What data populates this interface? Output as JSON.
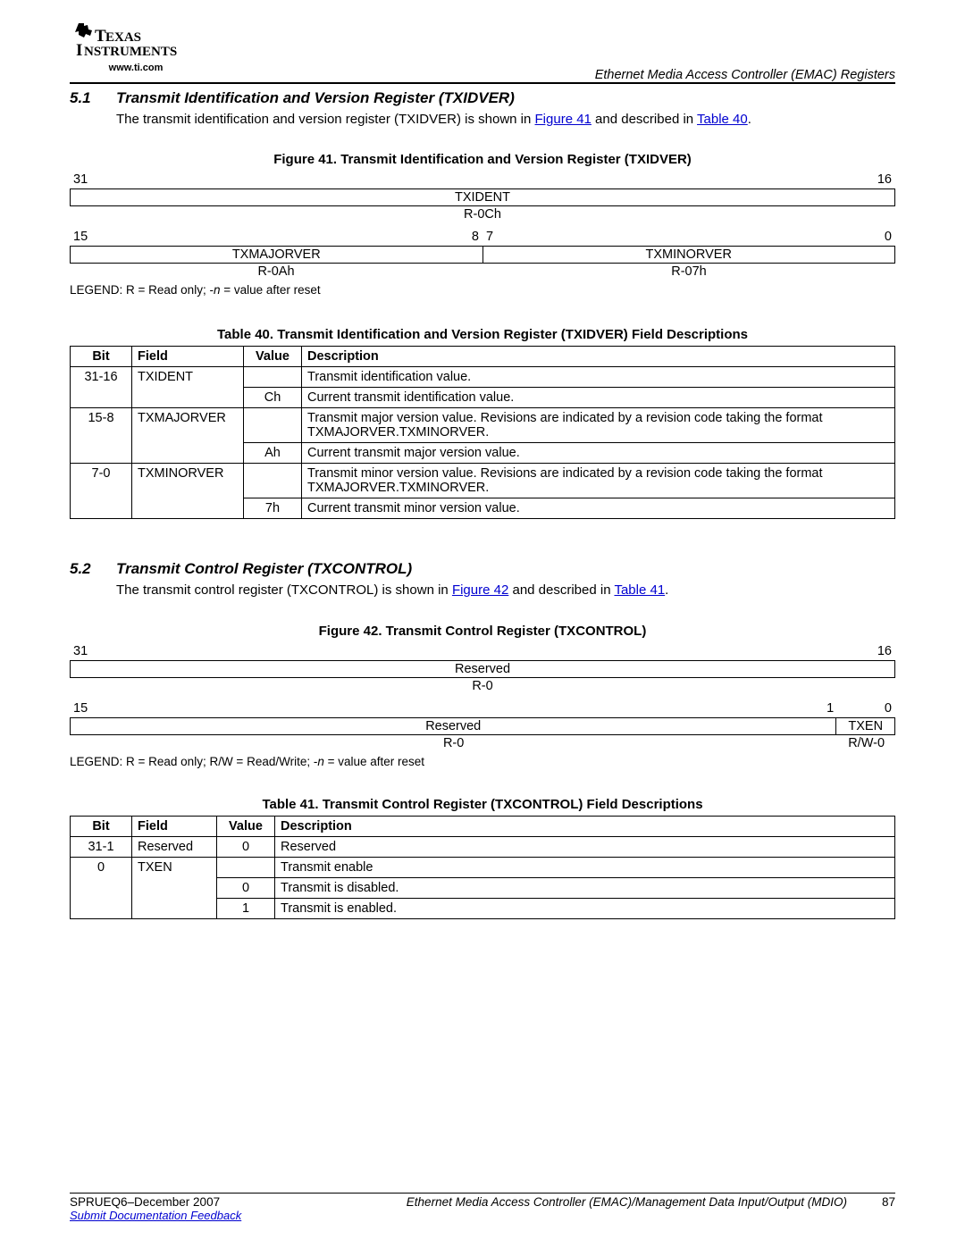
{
  "header": {
    "ti_url": "www.ti.com",
    "right_text": "Ethernet Media Access Controller (EMAC) Registers"
  },
  "section51": {
    "num": "5.1",
    "title": "Transmit Identification and Version Register (TXIDVER)",
    "intro_pre": "The transmit identification and version register (TXIDVER) is shown in ",
    "intro_link1": "Figure 41",
    "intro_mid": " and described in ",
    "intro_link2": "Table 40",
    "intro_post": "."
  },
  "figure41": {
    "title": "Figure 41. Transmit Identification and Version Register (TXIDVER)",
    "row1_bits": {
      "left": "31",
      "right": "16"
    },
    "row1_name": "TXIDENT",
    "row1_reset": "R-0Ch",
    "row2_bits": {
      "left": "15",
      "midL": "8",
      "midR": "7",
      "right": "0"
    },
    "row2_left_name": "TXMAJORVER",
    "row2_left_reset": "R-0Ah",
    "row2_right_name": "TXMINORVER",
    "row2_right_reset": "R-07h",
    "legend_prefix": "LEGEND: R = Read only; -",
    "legend_italic": "n",
    "legend_suffix": " = value after reset"
  },
  "table40": {
    "title": "Table 40. Transmit Identification and Version Register (TXIDVER) Field Descriptions",
    "head": {
      "bit": "Bit",
      "field": "Field",
      "value": "Value",
      "desc": "Description"
    },
    "r1": {
      "bit": "31-16",
      "field": "TXIDENT",
      "value": "",
      "desc": "Transmit identification value."
    },
    "r2": {
      "bit": "",
      "field": "",
      "value": "Ch",
      "desc": "Current transmit identification value."
    },
    "r3": {
      "bit": "15-8",
      "field": "TXMAJORVER",
      "value": "",
      "desc": "Transmit major version value. Revisions are indicated by a revision code taking the format TXMAJORVER.TXMINORVER."
    },
    "r4": {
      "bit": "",
      "field": "",
      "value": "Ah",
      "desc": "Current transmit major version value."
    },
    "r5": {
      "bit": "7-0",
      "field": "TXMINORVER",
      "value": "",
      "desc": "Transmit minor version value. Revisions are indicated by a revision code taking the format TXMAJORVER.TXMINORVER."
    },
    "r6": {
      "bit": "",
      "field": "",
      "value": "7h",
      "desc": "Current transmit minor version value."
    }
  },
  "section52": {
    "num": "5.2",
    "title": "Transmit Control Register (TXCONTROL)",
    "intro_pre": "The transmit control register (TXCONTROL) is shown in ",
    "intro_link1": "Figure 42",
    "intro_mid": " and described in ",
    "intro_link2": "Table 41",
    "intro_post": "."
  },
  "figure42": {
    "title": "Figure 42. Transmit Control Register (TXCONTROL)",
    "row1_bits": {
      "left": "31",
      "right": "16"
    },
    "row1_name": "Reserved",
    "row1_reset": "R-0",
    "row2_bits": {
      "left": "15",
      "midR": "1",
      "right": "0"
    },
    "row2_left_name": "Reserved",
    "row2_left_reset": "R-0",
    "row2_right_name": "TXEN",
    "row2_right_reset": "R/W-0",
    "legend_prefix": "LEGEND: R = Read only; R/W = Read/Write; -",
    "legend_italic": "n",
    "legend_suffix": " = value after reset"
  },
  "table41": {
    "title": "Table 41. Transmit Control Register (TXCONTROL) Field Descriptions",
    "head": {
      "bit": "Bit",
      "field": "Field",
      "value": "Value",
      "desc": "Description"
    },
    "r1": {
      "bit": "31-1",
      "field": "Reserved",
      "value": "0",
      "desc": "Reserved"
    },
    "r2": {
      "bit": "0",
      "field": "TXEN",
      "value": "",
      "desc": "Transmit enable"
    },
    "r3": {
      "bit": "",
      "field": "",
      "value": "0",
      "desc": "Transmit is disabled."
    },
    "r4": {
      "bit": "",
      "field": "",
      "value": "1",
      "desc": "Transmit is enabled."
    }
  },
  "footer": {
    "left": "SPRUEQ6–December 2007",
    "center": "Ethernet Media Access Controller (EMAC)/Management Data Input/Output (MDIO)",
    "page": "87",
    "feedback": "Submit Documentation Feedback"
  }
}
